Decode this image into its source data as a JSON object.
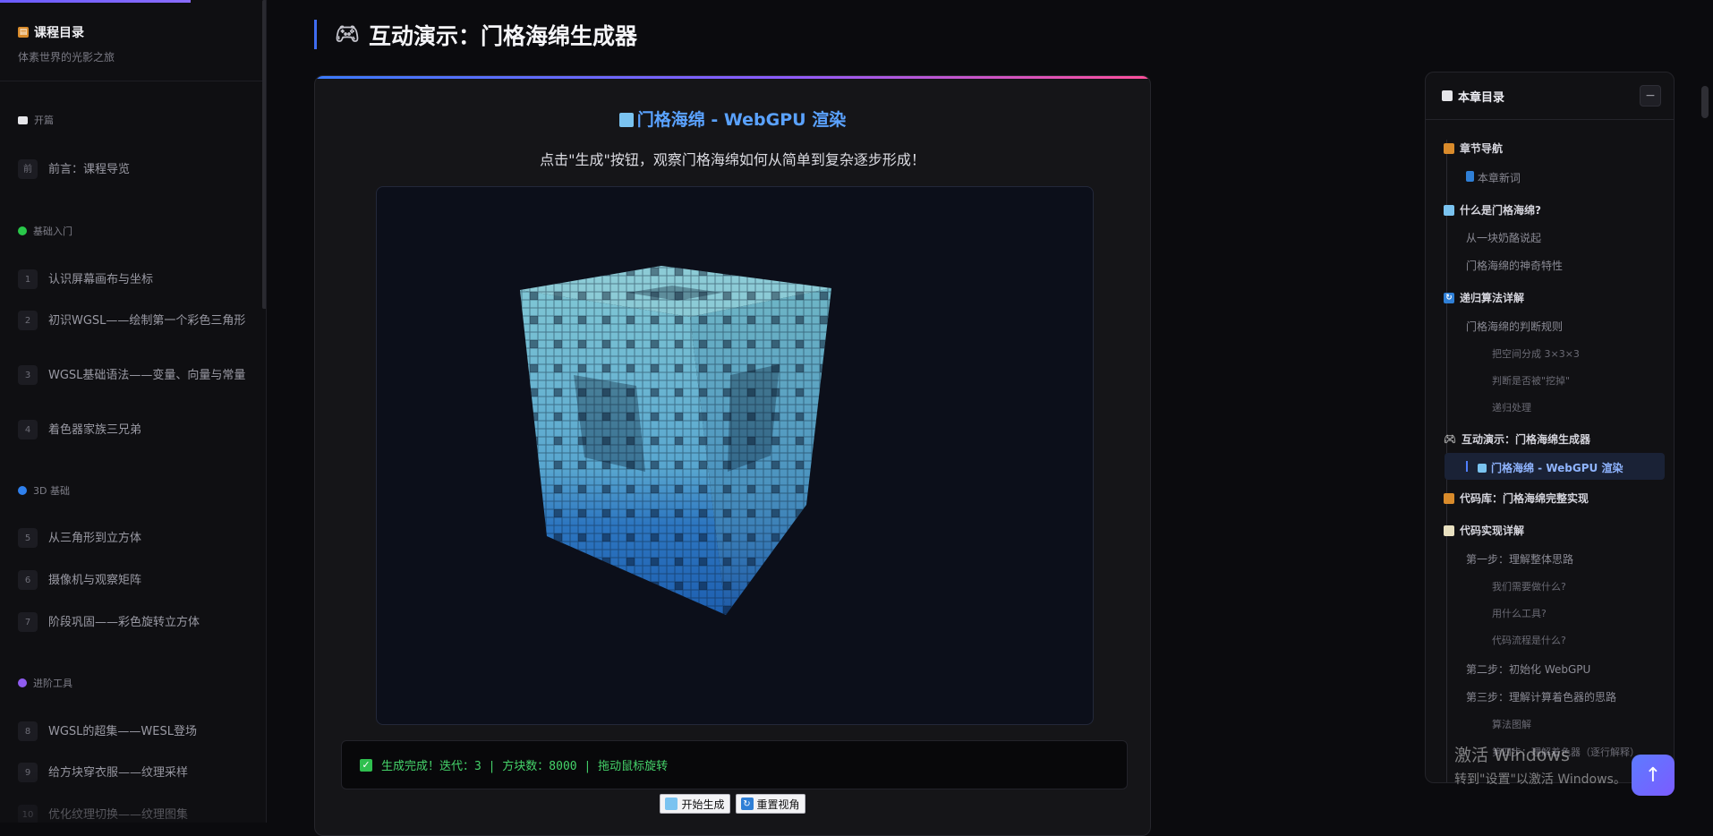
{
  "sidebar": {
    "title": "课程目录",
    "subtitle": "体素世界的光影之旅",
    "sections": [
      {
        "label": "开篇",
        "color": "#e6e6ea"
      },
      {
        "label": "基础入门",
        "color": "#29c84a"
      },
      {
        "label": "3D 基础",
        "color": "#2f80ed"
      },
      {
        "label": "进阶工具",
        "color": "#8f5cf0"
      }
    ],
    "items": [
      {
        "num": "前",
        "label": "前言：课程导览"
      },
      {
        "num": "1",
        "label": "认识屏幕画布与坐标"
      },
      {
        "num": "2",
        "label": "初识WGSL——绘制第一个彩色三角形"
      },
      {
        "num": "3",
        "label": "WGSL基础语法——变量、向量与常量"
      },
      {
        "num": "4",
        "label": "着色器家族三兄弟"
      },
      {
        "num": "5",
        "label": "从三角形到立方体"
      },
      {
        "num": "6",
        "label": "摄像机与观察矩阵"
      },
      {
        "num": "7",
        "label": "阶段巩固——彩色旋转立方体"
      },
      {
        "num": "8",
        "label": "WGSL的超集——WESL登场"
      },
      {
        "num": "9",
        "label": "给方块穿衣服——纹理采样"
      },
      {
        "num": "10",
        "label": "优化纹理切换——纹理图集"
      }
    ]
  },
  "main": {
    "title": "互动演示：门格海绵生成器",
    "card_title": "门格海绵 - WebGPU 渲染",
    "card_desc": "点击\"生成\"按钮，观察门格海绵如何从简单到复杂逐步形成！",
    "status": "生成完成！迭代：3 | 方块数：8000 | 拖动鼠标旋转",
    "buttons": {
      "generate": "开始生成",
      "reset": "重置视角"
    }
  },
  "toc": {
    "title": "本章目录",
    "collapse": "−",
    "items": [
      {
        "level": 1,
        "label": "章节导航",
        "icon": "clipboard-icon"
      },
      {
        "level": 2,
        "label": "本章新词",
        "icon": "book-icon"
      },
      {
        "level": 1,
        "label": "什么是门格海绵?",
        "icon": "cube-icon"
      },
      {
        "level": 2,
        "label": "从一块奶酪说起"
      },
      {
        "level": 2,
        "label": "门格海绵的神奇特性"
      },
      {
        "level": 1,
        "label": "递归算法详解",
        "icon": "cycle-icon"
      },
      {
        "level": 2,
        "label": "门格海绵的判断规则"
      },
      {
        "level": 3,
        "label": "把空间分成 3×3×3"
      },
      {
        "level": 3,
        "label": "判断是否被\"挖掉\""
      },
      {
        "level": 3,
        "label": "递归处理"
      },
      {
        "level": 1,
        "label": "互动演示：门格海绵生成器",
        "icon": "gamepad-icon"
      },
      {
        "level": 1,
        "label": "代码库：门格海绵完整实现",
        "icon": "books-icon"
      },
      {
        "level": 1,
        "label": "代码实现详解",
        "icon": "memo-icon"
      },
      {
        "level": 2,
        "label": "第一步：理解整体思路"
      },
      {
        "level": 3,
        "label": "我们需要做什么?"
      },
      {
        "level": 3,
        "label": "用什么工具?"
      },
      {
        "level": 3,
        "label": "代码流程是什么?"
      },
      {
        "level": 2,
        "label": "第二步：初始化 WebGPU"
      },
      {
        "level": 2,
        "label": "第三步：理解计算着色器的思路"
      },
      {
        "level": 3,
        "label": "算法图解"
      },
      {
        "level": 3,
        "label": "第四步：理解着色器（逐行解释）"
      }
    ],
    "active": "门格海绵 - WebGPU 渲染"
  },
  "watermark": {
    "line1": "激活 Windows",
    "line2": "转到\"设置\"以激活 Windows。"
  },
  "fab": "↑"
}
